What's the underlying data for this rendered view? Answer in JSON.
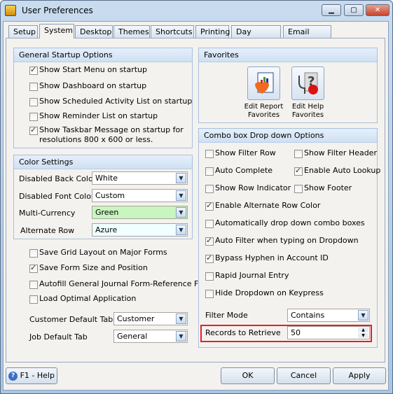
{
  "window": {
    "title": "User Preferences",
    "minimize": "▁",
    "maximize": "▢",
    "close": "✕"
  },
  "tabs": [
    {
      "label": "Setup"
    },
    {
      "label": "System",
      "active": true
    },
    {
      "label": "Desktop"
    },
    {
      "label": "Themes"
    },
    {
      "label": "Shortcuts"
    },
    {
      "label": "Printing"
    },
    {
      "label": "Day Planner"
    },
    {
      "label": "Email Setup"
    }
  ],
  "startup": {
    "title": "General Startup Options",
    "items": [
      {
        "label": "Show Start Menu on startup",
        "checked": true
      },
      {
        "label": "Show Dashboard on startup",
        "checked": false
      },
      {
        "label": "Show Scheduled Activity List on startup",
        "checked": false
      },
      {
        "label": "Show Reminder List on startup",
        "checked": false
      },
      {
        "label": "Show Taskbar Message on startup for",
        "label2": "resolutions 800 x 600 or less.",
        "checked": true
      }
    ]
  },
  "colors": {
    "title": "Color Settings",
    "rows": [
      {
        "label": "Disabled Back Color",
        "value": "White",
        "bg": "#ffffff"
      },
      {
        "label": "Disabled Font Color",
        "value": "Custom",
        "bg": "#ffffff"
      },
      {
        "label": "Multi-Currency",
        "value": "Green",
        "bg": "#c8f5c0"
      },
      {
        "label": "Alternate Row",
        "value": "Azure",
        "bg": "#f0ffff"
      }
    ]
  },
  "misc": {
    "items": [
      {
        "label": "Save Grid Layout on Major Forms",
        "checked": false
      },
      {
        "label": "Save Form Size and Position",
        "checked": true
      },
      {
        "label": "Autofill General Journal Form-Reference Field",
        "checked": false
      },
      {
        "label": "Load Optimal Application",
        "checked": false
      }
    ],
    "customer_tab_label": "Customer Default Tab",
    "customer_tab_value": "Customer",
    "job_tab_label": "Job Default Tab",
    "job_tab_value": "General"
  },
  "favorites": {
    "title": "Favorites",
    "report_l1": "Edit Report",
    "report_l2": "Favorites",
    "help_l1": "Edit Help",
    "help_l2": "Favorites"
  },
  "combo": {
    "title": "Combo box Drop down Options",
    "items": [
      {
        "label": "Show Filter Row",
        "checked": false
      },
      {
        "label": "Show Filter Header",
        "checked": false
      },
      {
        "label": "Auto Complete",
        "checked": false
      },
      {
        "label": "Enable Auto Lookup",
        "checked": true
      },
      {
        "label": "Show Row Indicator",
        "checked": false
      },
      {
        "label": "Show Footer",
        "checked": false
      },
      {
        "label": "Enable Alternate Row Color",
        "checked": true
      },
      {
        "label": "Automatically drop down combo boxes",
        "checked": false
      },
      {
        "label": "Auto Filter when typing on Dropdown",
        "checked": true
      },
      {
        "label": "Bypass Hyphen in Account ID",
        "checked": true
      },
      {
        "label": "Rapid Journal Entry",
        "checked": false
      },
      {
        "label": "Hide Dropdown on Keypress",
        "checked": false
      }
    ],
    "filter_label": "Filter Mode",
    "filter_value": "Contains",
    "records_label": "Records to Retrieve",
    "records_value": "50",
    "highlight_color": "#e0202a"
  },
  "buttons": {
    "help": "F1 - Help",
    "ok": "OK",
    "cancel": "Cancel",
    "apply": "Apply"
  }
}
